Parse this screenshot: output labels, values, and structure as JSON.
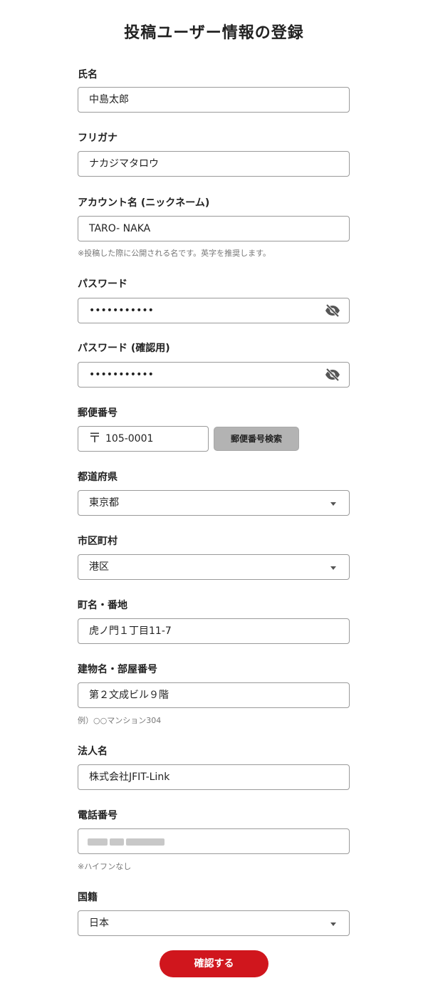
{
  "page": {
    "title": "投稿ユーザー情報の登録"
  },
  "name": {
    "label": "氏名",
    "value": "中島太郎"
  },
  "furigana": {
    "label": "フリガナ",
    "value": "ナカジマタロウ"
  },
  "nickname": {
    "label": "アカウント名 (ニックネーム)",
    "value": "TARO- NAKA",
    "help": "※投稿した際に公開される名です。英字を推奨します。"
  },
  "password": {
    "label": "パスワード",
    "value": "•••••••••••",
    "toggle_icon": "eye-off-icon"
  },
  "password_confirm": {
    "label": "パスワード (確認用)",
    "value": "•••••••••••",
    "toggle_icon": "eye-off-icon"
  },
  "postal": {
    "label": "郵便番号",
    "symbol": "〒",
    "value": "105-0001",
    "search_label": "郵便番号検索"
  },
  "prefecture": {
    "label": "都道府県",
    "value": "東京都"
  },
  "city": {
    "label": "市区町村",
    "value": "港区"
  },
  "street": {
    "label": "町名・番地",
    "value": "虎ノ門１丁目11-7"
  },
  "building": {
    "label": "建物名・部屋番号",
    "value": "第２文成ビル９階",
    "help": "例）○○マンション304"
  },
  "company": {
    "label": "法人名",
    "value": "株式会社JFIT-Link"
  },
  "phone": {
    "label": "電話番号",
    "help": "※ハイフンなし"
  },
  "nationality": {
    "label": "国籍",
    "value": "日本"
  },
  "submit": {
    "label": "確認する"
  },
  "colors": {
    "accent": "#d0161d",
    "border": "#9a9a9a",
    "button_gray": "#b3b3b3"
  }
}
